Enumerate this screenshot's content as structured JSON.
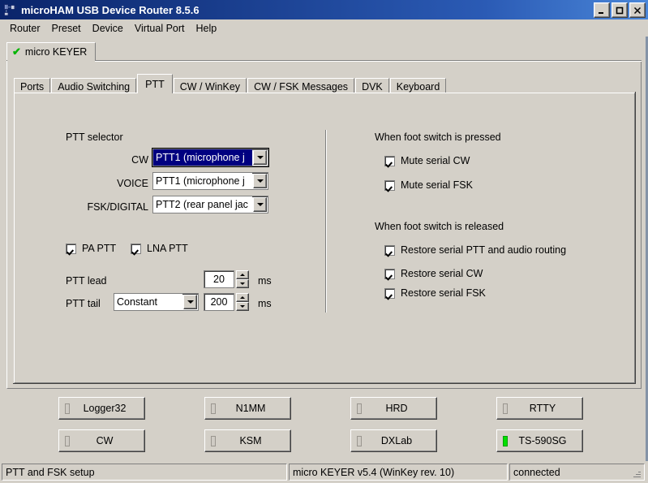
{
  "window": {
    "title": "microHAM USB Device Router 8.5.6",
    "icon": "usb-device-icon",
    "controls": {
      "minimize": "minimize-button",
      "maximize": "maximize-button",
      "close": "close-button"
    },
    "accent_title_color": "#0a246a"
  },
  "menu": {
    "items": [
      "Router",
      "Preset",
      "Device",
      "Virtual Port",
      "Help"
    ]
  },
  "device_tabs": [
    {
      "label": "micro KEYER",
      "status_icon": "green-check-icon",
      "selected": true
    }
  ],
  "tabs": [
    {
      "label": "Ports",
      "selected": false
    },
    {
      "label": "Audio Switching",
      "selected": false
    },
    {
      "label": "PTT",
      "selected": true
    },
    {
      "label": "CW / WinKey",
      "selected": false
    },
    {
      "label": "CW / FSK Messages",
      "selected": false
    },
    {
      "label": "DVK",
      "selected": false
    },
    {
      "label": "Keyboard",
      "selected": false
    }
  ],
  "ptt_page": {
    "selector": {
      "title": "PTT selector",
      "rows": [
        {
          "label": "CW",
          "value": "PTT1 (microphone j",
          "focused": true
        },
        {
          "label": "VOICE",
          "value": "PTT1 (microphone j",
          "focused": false
        },
        {
          "label": "FSK/DIGITAL",
          "value": "PTT2 (rear panel jac",
          "focused": false
        }
      ]
    },
    "amp_checkboxes": [
      {
        "label": "PA PTT",
        "checked": true
      },
      {
        "label": "LNA PTT",
        "checked": true
      }
    ],
    "timing": {
      "lead_label": "PTT lead",
      "lead_value": "20",
      "lead_unit": "ms",
      "tail_label": "PTT tail",
      "tail_mode": "Constant",
      "tail_value": "200",
      "tail_unit": "ms"
    },
    "foot_pressed": {
      "title": "When foot switch is pressed",
      "items": [
        {
          "label": "Mute serial CW",
          "checked": true
        },
        {
          "label": "Mute serial FSK",
          "checked": true
        }
      ]
    },
    "foot_released": {
      "title": "When foot switch is released",
      "items": [
        {
          "label": "Restore serial PTT and audio routing",
          "checked": true
        },
        {
          "label": "Restore serial CW",
          "checked": true
        },
        {
          "label": "Restore serial FSK",
          "checked": true
        }
      ]
    }
  },
  "preset_buttons": [
    {
      "label": "Logger32",
      "led": "off"
    },
    {
      "label": "N1MM",
      "led": "off"
    },
    {
      "label": "HRD",
      "led": "off"
    },
    {
      "label": "RTTY",
      "led": "off"
    },
    {
      "label": "CW",
      "led": "off"
    },
    {
      "label": "KSM",
      "led": "off"
    },
    {
      "label": "DXLab",
      "led": "off"
    },
    {
      "label": "TS-590SG",
      "led": "on"
    }
  ],
  "status_bar": {
    "pane1": "PTT and FSK setup",
    "pane2": "micro KEYER v5.4 (WinKey rev. 10)",
    "pane3": "connected"
  },
  "colors": {
    "face": "#d4d0c8",
    "selection": "#000080",
    "led_on": "#00e000",
    "check_green": "#00b400"
  }
}
